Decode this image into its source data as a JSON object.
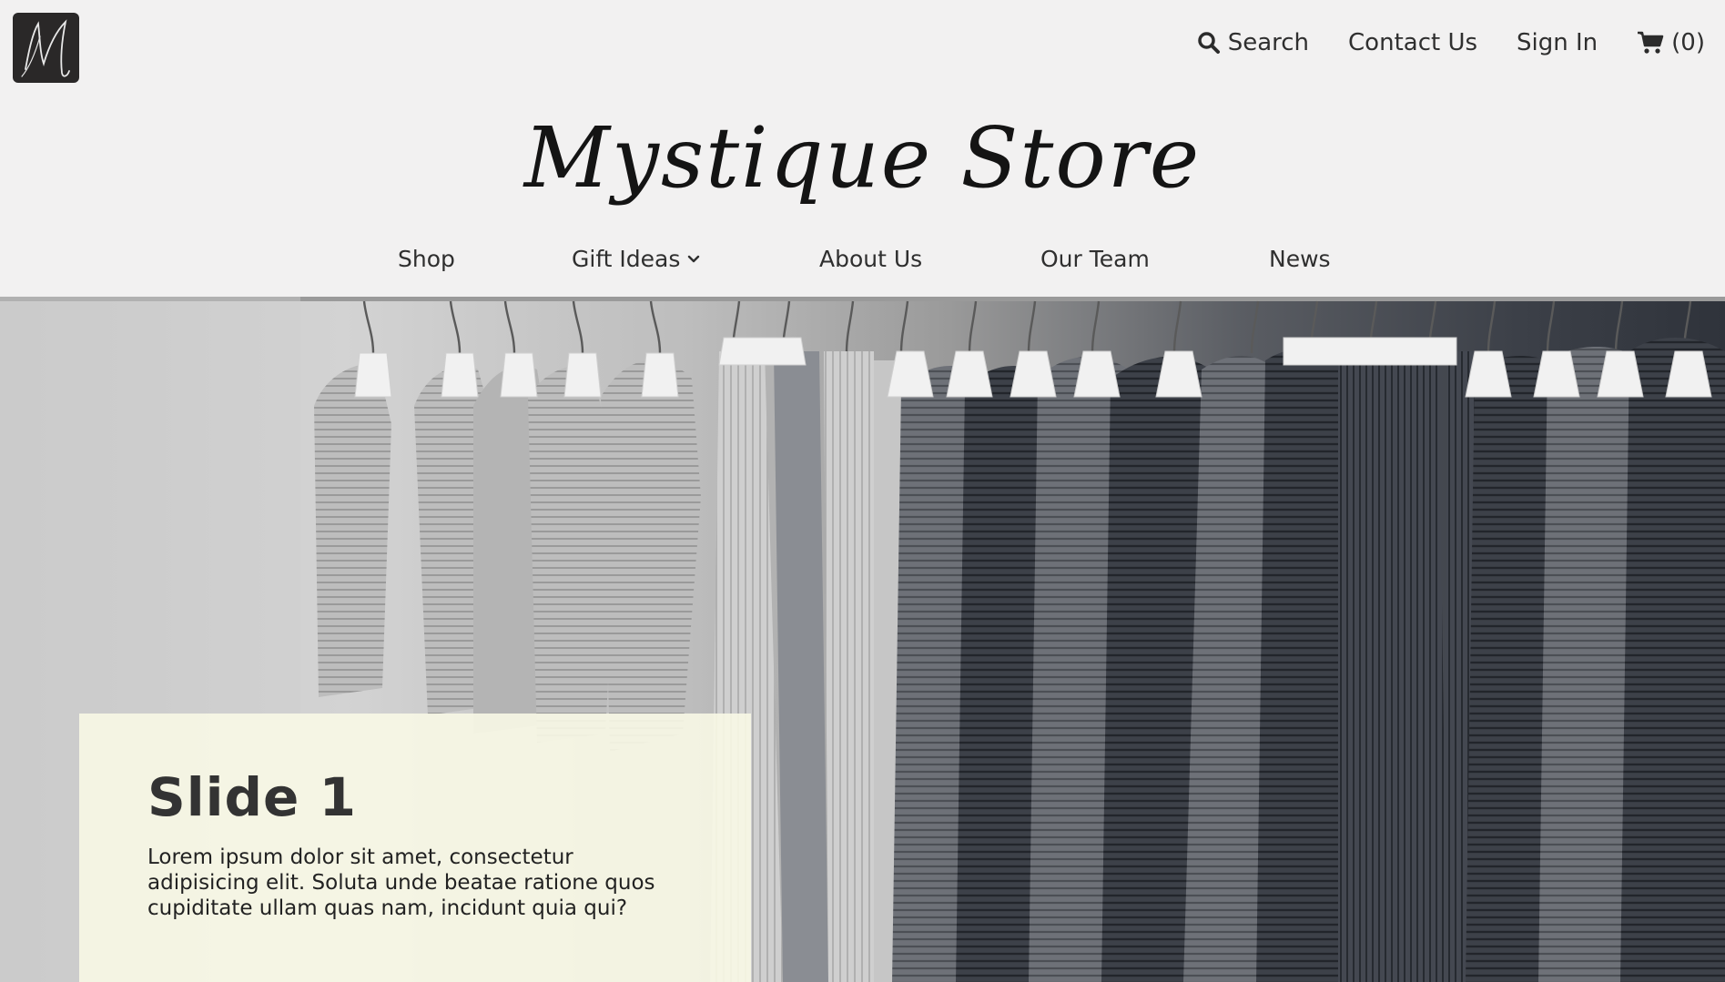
{
  "header": {
    "brand": "Mystique Store",
    "logo_icon": "script-m-logo",
    "top_links": {
      "search_label": "Search",
      "contact_label": "Contact Us",
      "signin_label": "Sign In",
      "cart_count": "(0)"
    }
  },
  "main_nav": {
    "shop": "Shop",
    "gift_ideas": "Gift Ideas",
    "about_us": "About Us",
    "our_team": "Our Team",
    "news": "News"
  },
  "hero": {
    "image_subject": "clothing rack with pleated garments",
    "slide": {
      "title": "Slide 1",
      "text": "Lorem ipsum dolor sit amet, consectetur adipisicing elit. Soluta unde beatae ratione quos cupiditate ullam quas nam, incidunt quia qui?"
    }
  },
  "colors": {
    "page_background": "#f2f1f1",
    "text": "#2f2f2f",
    "logo_background": "#2a2828",
    "slide_card": "#f8f8e6"
  }
}
